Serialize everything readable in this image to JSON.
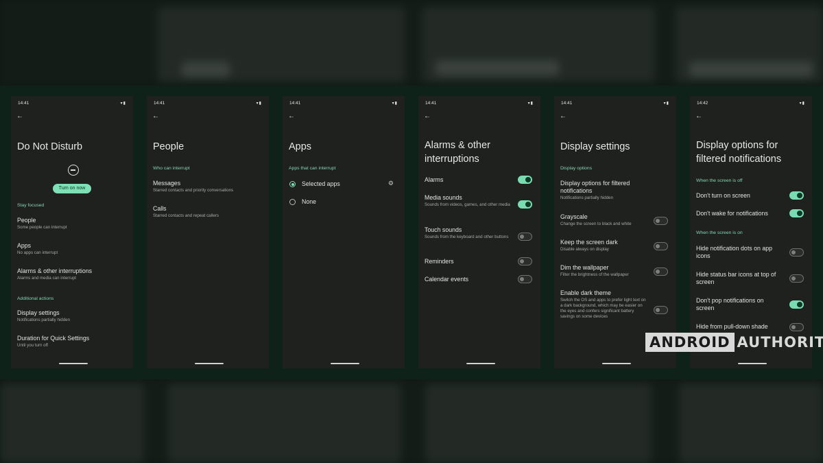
{
  "screens": [
    {
      "time": "14:41",
      "title": "Do Not Disturb",
      "button": "Turn on now",
      "sections": [
        "Stay focused",
        "Additional actions"
      ],
      "items": [
        {
          "title": "People",
          "sub": "Some people can interrupt"
        },
        {
          "title": "Apps",
          "sub": "No apps can interrupt"
        },
        {
          "title": "Alarms & other interruptions",
          "sub": "Alarms and media can interrupt"
        },
        {
          "title": "Display settings",
          "sub": "Notifications partially hidden"
        },
        {
          "title": "Duration for Quick Settings",
          "sub": "Until you turn off"
        }
      ]
    },
    {
      "time": "14:41",
      "title": "People",
      "sections": [
        "Who can interrupt"
      ],
      "items": [
        {
          "title": "Messages",
          "sub": "Starred contacts and priority conversations"
        },
        {
          "title": "Calls",
          "sub": "Starred contacts and repeat callers"
        }
      ]
    },
    {
      "time": "14:41",
      "title": "Apps",
      "sections": [
        "Apps that can interrupt"
      ],
      "options": [
        {
          "label": "Selected apps",
          "selected": true
        },
        {
          "label": "None",
          "selected": false
        }
      ]
    },
    {
      "time": "14:41",
      "title": "Alarms & other interruptions",
      "items": [
        {
          "title": "Alarms",
          "sub": "",
          "on": true
        },
        {
          "title": "Media sounds",
          "sub": "Sounds from videos, games, and other media",
          "on": true
        },
        {
          "title": "Touch sounds",
          "sub": "Sounds from the keyboard and other buttons",
          "on": false
        },
        {
          "title": "Reminders",
          "sub": "",
          "on": false
        },
        {
          "title": "Calendar events",
          "sub": "",
          "on": false
        }
      ]
    },
    {
      "time": "14:41",
      "title": "Display settings",
      "sections": [
        "Display options"
      ],
      "items": [
        {
          "title": "Display options for filtered notifications",
          "sub": "Notifications partially hidden"
        },
        {
          "title": "Grayscale",
          "sub": "Change the screen to black and white",
          "on": false
        },
        {
          "title": "Keep the screen dark",
          "sub": "Disable always on display",
          "on": false
        },
        {
          "title": "Dim the wallpaper",
          "sub": "Filter the brightness of the wallpaper",
          "on": false
        },
        {
          "title": "Enable dark theme",
          "sub": "Switch the OS and apps to prefer light text on a dark background, which may be easier on the eyes and confers significant battery savings on some devices",
          "on": false
        }
      ]
    },
    {
      "time": "14:42",
      "title": "Display options for filtered notifications",
      "sections": [
        "When the screen is off",
        "When the screen is on"
      ],
      "items": [
        {
          "title": "Don't turn on screen",
          "on": true
        },
        {
          "title": "Don't wake for notifications",
          "on": true
        },
        {
          "title": "Hide notification dots on app icons",
          "on": false
        },
        {
          "title": "Hide status bar icons at top of screen",
          "on": false
        },
        {
          "title": "Don't pop notifications on screen",
          "on": true
        },
        {
          "title": "Hide from pull-down shade",
          "on": false
        }
      ]
    }
  ],
  "watermark": {
    "boxed": "ANDROID",
    "plain": "AUTHORITY"
  },
  "colors": {
    "accent": "#7fe0b6",
    "section": "#86d6b0",
    "panel": "#1f211f",
    "strip": "#0f2219"
  }
}
